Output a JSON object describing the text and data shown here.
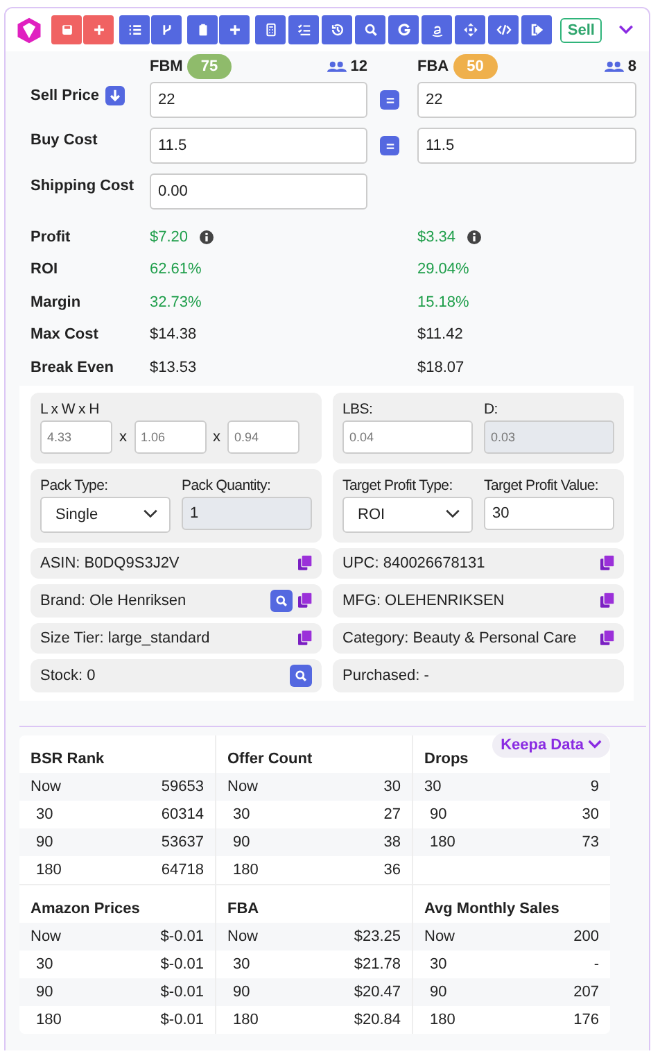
{
  "toolbar": {
    "buttons": [
      {
        "kind": "save",
        "color": "#f06262"
      },
      {
        "kind": "plus",
        "color": "#f06262"
      },
      {
        "kind": "list",
        "color": "#5468e0"
      },
      {
        "kind": "branch",
        "color": "#5468e0"
      },
      {
        "kind": "clipboard",
        "color": "#5468e0"
      },
      {
        "kind": "plus",
        "color": "#5468e0"
      },
      {
        "kind": "calculator",
        "color": "#5468e0"
      },
      {
        "kind": "checklist",
        "color": "#5468e0"
      },
      {
        "kind": "history",
        "color": "#5468e0"
      },
      {
        "kind": "search",
        "color": "#5468e0"
      },
      {
        "kind": "g",
        "color": "#5468e0"
      },
      {
        "kind": "a",
        "color": "#5468e0"
      },
      {
        "kind": "move",
        "color": "#5468e0"
      },
      {
        "kind": "code",
        "color": "#5468e0"
      },
      {
        "kind": "exit",
        "color": "#5468e0"
      }
    ],
    "mode": "Sell"
  },
  "channels": [
    {
      "label": "FBM",
      "score": "75",
      "color": "#8fbb6b",
      "sellers": "12"
    },
    {
      "label": "FBA",
      "score": "50",
      "color": "#efb04c",
      "sellers": "8"
    }
  ],
  "inputs": [
    {
      "kind": "sell",
      "label": "Sell Price",
      "values": [
        "22",
        "22"
      ]
    },
    {
      "kind": "buy",
      "label": "Buy Cost",
      "values": [
        "11.5",
        "11.5"
      ]
    },
    {
      "kind": "shipping",
      "label": "Shipping Cost",
      "values": [
        "0.00"
      ]
    }
  ],
  "metrics": [
    {
      "label": "Profit",
      "values": [
        "$7.20",
        "$3.34"
      ],
      "positive": true,
      "info": true
    },
    {
      "label": "ROI",
      "values": [
        "62.61%",
        "29.04%"
      ],
      "positive": true
    },
    {
      "label": "Margin",
      "values": [
        "32.73%",
        "15.18%"
      ],
      "positive": true
    },
    {
      "label": "Max Cost",
      "values": [
        "$14.38",
        "$11.42"
      ],
      "positive": false
    },
    {
      "label": "Break Even",
      "values": [
        "$13.53",
        "$18.07"
      ],
      "positive": false
    }
  ],
  "dimensions": {
    "label": "L x W x H",
    "values": [
      "4.33",
      "1.06",
      "0.94"
    ],
    "separators": [
      "x",
      "x"
    ]
  },
  "weight": [
    {
      "label": "LBS:",
      "value": "0.04"
    },
    {
      "label": "D:",
      "value": "0.03",
      "disabled": true
    }
  ],
  "pack": [
    {
      "kind": "select",
      "label": "Pack Type:",
      "value": "Single"
    },
    {
      "kind": "input",
      "label": "Pack Quantity:",
      "value": "1",
      "disabled": true
    }
  ],
  "target": [
    {
      "kind": "select",
      "label": "Target Profit Type:",
      "value": "ROI"
    },
    {
      "kind": "input",
      "label": "Target Profit Value:",
      "value": "30"
    }
  ],
  "info": [
    {
      "text": "ASIN: B0DQ9S3J2V",
      "copy": true
    },
    {
      "text": "UPC: 840026678131",
      "copy": true
    },
    {
      "text": "Brand: Ole Henriksen",
      "search": true,
      "copy": true
    },
    {
      "text": "MFG: OLEHENRIKSEN",
      "copy": true
    },
    {
      "text": "Size Tier: large_standard",
      "copy": true
    },
    {
      "text": "Category: Beauty & Personal Care",
      "copy": true
    },
    {
      "text": "Stock: 0",
      "search": true
    },
    {
      "text": "Purchased: -"
    }
  ],
  "keepa": {
    "button": "Keepa Data",
    "tables": [
      {
        "title": "BSR Rank",
        "rows": [
          [
            "Now",
            "59653"
          ],
          [
            "30",
            "60314"
          ],
          [
            "90",
            "53637"
          ],
          [
            "180",
            "64718"
          ]
        ]
      },
      {
        "title": "Offer Count",
        "rows": [
          [
            "Now",
            "30"
          ],
          [
            "30",
            "27"
          ],
          [
            "90",
            "38"
          ],
          [
            "180",
            "36"
          ]
        ]
      },
      {
        "title": "Drops",
        "rows": [
          [
            "30",
            "9"
          ],
          [
            "90",
            "30"
          ],
          [
            "180",
            "73"
          ]
        ]
      },
      {
        "title": "Amazon Prices",
        "rows": [
          [
            "Now",
            "$-0.01"
          ],
          [
            "30",
            "$-0.01"
          ],
          [
            "90",
            "$-0.01"
          ],
          [
            "180",
            "$-0.01"
          ]
        ]
      },
      {
        "title": "FBA",
        "rows": [
          [
            "Now",
            "$23.25"
          ],
          [
            "30",
            "$21.78"
          ],
          [
            "90",
            "$20.47"
          ],
          [
            "180",
            "$20.84"
          ]
        ]
      },
      {
        "title": "Avg Monthly Sales",
        "rows": [
          [
            "Now",
            "200"
          ],
          [
            "30",
            "-"
          ],
          [
            "90",
            "207"
          ],
          [
            "180",
            "176"
          ]
        ]
      }
    ]
  }
}
